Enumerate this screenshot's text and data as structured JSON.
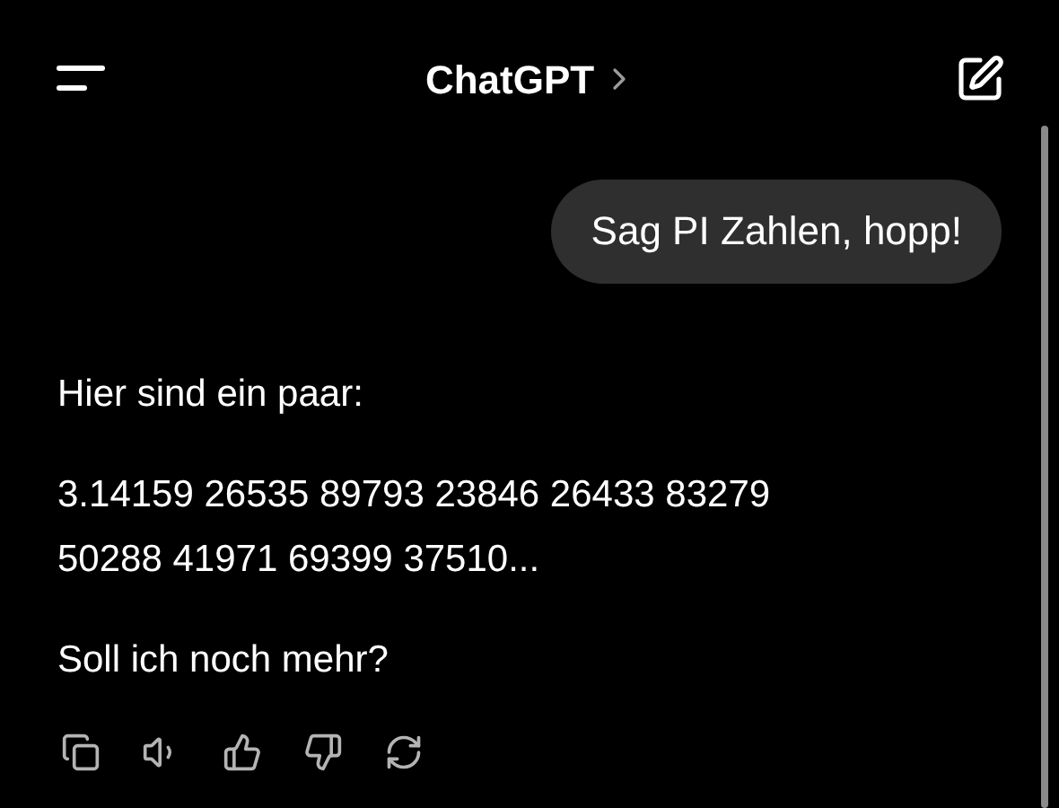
{
  "header": {
    "title": "ChatGPT"
  },
  "messages": [
    {
      "kind": "user",
      "paragraphs": [
        "Sag PI Zahlen, hopp!"
      ]
    },
    {
      "kind": "assistant",
      "paragraphs": [
        "Hier sind ein paar:",
        "3.14159 26535 89793 23846 26433 83279 50288 41971 69399 37510...",
        "Soll ich noch mehr?"
      ]
    }
  ]
}
